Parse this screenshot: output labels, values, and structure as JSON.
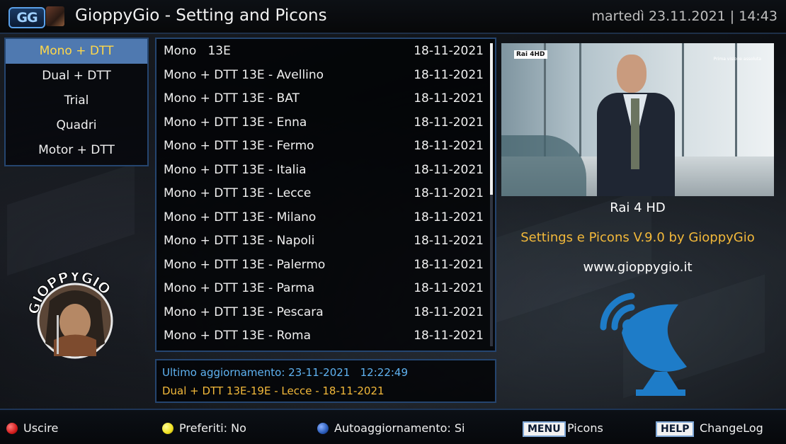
{
  "header": {
    "logo_text": "GG",
    "title": "GioppyGio - Setting and Picons",
    "datetime": "martedì 23.11.2021 | 14:43"
  },
  "menu": {
    "items": [
      {
        "label": "Mono + DTT",
        "selected": true
      },
      {
        "label": "Dual + DTT",
        "selected": false
      },
      {
        "label": "Trial",
        "selected": false
      },
      {
        "label": "Quadri",
        "selected": false
      },
      {
        "label": "Motor + DTT",
        "selected": false
      }
    ]
  },
  "list": {
    "rows": [
      {
        "name": "Mono   13E",
        "date": "18-11-2021"
      },
      {
        "name": "Mono + DTT 13E - Avellino",
        "date": "18-11-2021"
      },
      {
        "name": "Mono + DTT 13E - BAT",
        "date": "18-11-2021"
      },
      {
        "name": "Mono + DTT 13E - Enna",
        "date": "18-11-2021"
      },
      {
        "name": "Mono + DTT 13E - Fermo",
        "date": "18-11-2021"
      },
      {
        "name": "Mono + DTT 13E - Italia",
        "date": "18-11-2021"
      },
      {
        "name": "Mono + DTT 13E - Lecce",
        "date": "18-11-2021"
      },
      {
        "name": "Mono + DTT 13E - Milano",
        "date": "18-11-2021"
      },
      {
        "name": "Mono + DTT 13E - Napoli",
        "date": "18-11-2021"
      },
      {
        "name": "Mono + DTT 13E - Palermo",
        "date": "18-11-2021"
      },
      {
        "name": "Mono + DTT 13E - Parma",
        "date": "18-11-2021"
      },
      {
        "name": "Mono + DTT 13E - Pescara",
        "date": "18-11-2021"
      },
      {
        "name": "Mono + DTT 13E - Roma",
        "date": "18-11-2021"
      }
    ],
    "scroll_fraction_visible": 0.5
  },
  "info": {
    "last_update": "Ultimo aggiornamento: 23-11-2021   12:22:49",
    "last_config": "Dual + DTT 13E-19E - Lecce - 18-11-2021"
  },
  "preview": {
    "channel_logo": "Rai 4HD",
    "tagline": "Prima visione assoluta",
    "channel_name": "Rai 4 HD"
  },
  "branding": {
    "avatar_text": "GIOPPYGIO",
    "version": "Settings e Picons V.9.0 by GioppyGio",
    "website": "www.gioppygio.it",
    "satellite_icon": "satellite-dish-icon",
    "accent_color": "#1e7cc8"
  },
  "footer": {
    "red": {
      "label": "Uscire",
      "color": "#d21e1e"
    },
    "yellow": {
      "label": "Preferiti: No",
      "color": "#f0e020"
    },
    "blue": {
      "label": "Autoaggiornamento: Si",
      "color": "#2a5cb8"
    },
    "menu_key": "MENU",
    "menu_label": "Picons",
    "help_key": "HELP",
    "help_label": "ChangeLog"
  }
}
